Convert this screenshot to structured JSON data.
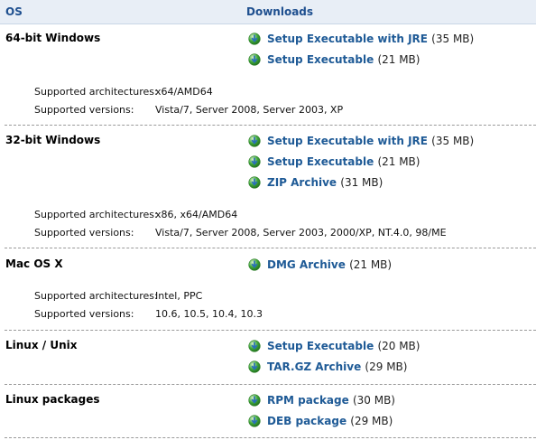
{
  "header": {
    "os_label": "OS",
    "downloads_label": "Downloads"
  },
  "sections": [
    {
      "os": "64-bit Windows",
      "downloads": [
        {
          "label": "Setup Executable with JRE",
          "size": "(35 MB)",
          "icon": "download-globe-icon"
        },
        {
          "label": "Setup Executable",
          "size": "(21 MB)",
          "icon": "download-globe-icon"
        }
      ],
      "arch_label": "Supported architectures:",
      "arch_value": "x64/AMD64",
      "versions_label": "Supported versions:",
      "versions_value": "Vista/7, Server 2008, Server 2003, XP"
    },
    {
      "os": "32-bit Windows",
      "downloads": [
        {
          "label": "Setup Executable with JRE",
          "size": "(35 MB)",
          "icon": "download-globe-icon"
        },
        {
          "label": "Setup Executable",
          "size": "(21 MB)",
          "icon": "download-globe-icon"
        },
        {
          "label": "ZIP Archive",
          "size": "(31 MB)",
          "icon": "download-globe-icon"
        }
      ],
      "arch_label": "Supported architectures:",
      "arch_value": "x86, x64/AMD64",
      "versions_label": "Supported versions:",
      "versions_value": "Vista/7, Server 2008, Server 2003, 2000/XP, NT.4.0, 98/ME"
    },
    {
      "os": "Mac OS X",
      "downloads": [
        {
          "label": "DMG Archive",
          "size": "(21 MB)",
          "icon": "download-globe-icon"
        }
      ],
      "arch_label": "Supported architectures:",
      "arch_value": "Intel, PPC",
      "versions_label": "Supported versions:",
      "versions_value": "10.6, 10.5, 10.4, 10.3"
    },
    {
      "os": "Linux / Unix",
      "downloads": [
        {
          "label": "Setup Executable",
          "size": "(20 MB)",
          "icon": "download-globe-icon"
        },
        {
          "label": "TAR.GZ Archive",
          "size": "(29 MB)",
          "icon": "download-globe-icon"
        }
      ]
    },
    {
      "os": "Linux packages",
      "downloads": [
        {
          "label": "RPM package",
          "size": "(30 MB)",
          "icon": "download-globe-icon"
        },
        {
          "label": "DEB package",
          "size": "(29 MB)",
          "icon": "download-globe-icon"
        }
      ]
    }
  ],
  "colors": {
    "link": "#1e5a96",
    "header_bg": "#e8eef6",
    "header_text": "#1e4f8f",
    "icon_green": "#3fa63a",
    "icon_blue": "#2a6fb8"
  }
}
